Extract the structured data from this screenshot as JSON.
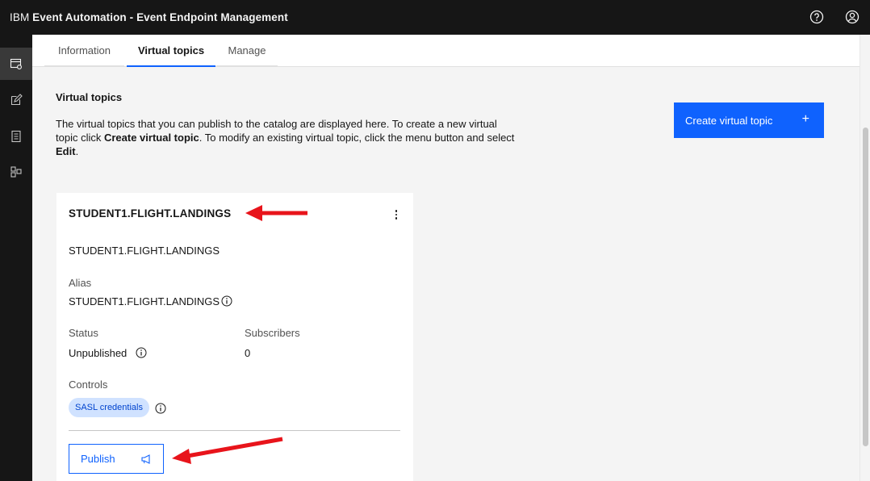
{
  "header": {
    "brand_prefix": "IBM",
    "brand_product": "Event Automation - Event Endpoint Management",
    "icons": [
      "help-icon",
      "user-avatar-icon"
    ]
  },
  "sidenav": {
    "items": [
      {
        "icon": "catalog-settings-icon",
        "active": true
      },
      {
        "icon": "edit-icon",
        "active": false
      },
      {
        "icon": "document-icon",
        "active": false
      },
      {
        "icon": "topology-icon",
        "active": false
      }
    ]
  },
  "tabs": [
    {
      "label": "Information",
      "selected": false
    },
    {
      "label": "Virtual topics",
      "selected": true
    },
    {
      "label": "Manage",
      "selected": false
    }
  ],
  "main": {
    "title": "Virtual topics",
    "desc_line1": "The virtual topics that you can publish to the catalog are displayed here. To create a new virtual",
    "desc_line2_a": "topic click ",
    "desc_line2_b": "Create virtual topic",
    "desc_line2_c": ". To modify an existing virtual topic, click the menu button and select",
    "desc_line3_b": "Edit",
    "desc_line3_c": ".",
    "create_button": "Create virtual topic",
    "create_button_icon": "+"
  },
  "card": {
    "title": "STUDENT1.FLIGHT.LANDINGS",
    "topic_name": "STUDENT1.FLIGHT.LANDINGS",
    "alias_label": "Alias",
    "alias_value": "STUDENT1.FLIGHT.LANDINGS",
    "status_label": "Status",
    "status_value": "Unpublished",
    "subscribers_label": "Subscribers",
    "subscribers_value": "0",
    "controls_label": "Controls",
    "controls_tag": "SASL credentials",
    "publish_button": "Publish"
  },
  "colors": {
    "header_bg": "#161616",
    "primary": "#0f62fe",
    "tag_bg": "#d0e2ff",
    "tag_text": "#0043ce",
    "annotation_arrow": "#e8141b"
  }
}
